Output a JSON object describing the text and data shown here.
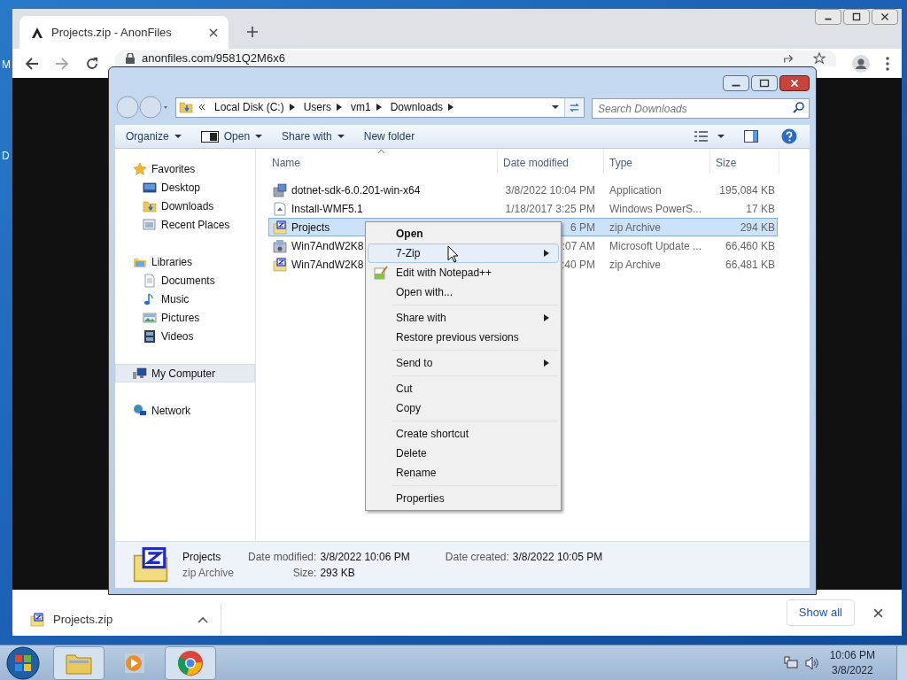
{
  "desktop": {
    "edge_labels": [
      "M",
      "D"
    ]
  },
  "browser": {
    "tabs": [
      {
        "title": "Projects.zip - AnonFiles",
        "selected": true
      }
    ],
    "url": "anonfiles.com/9581Q2M6x6",
    "downloads": [
      {
        "name": "Projects.zip"
      }
    ],
    "show_all": "Show all"
  },
  "explorer": {
    "breadcrumb": [
      "Local Disk (C:)",
      "Users",
      "vm1",
      "Downloads"
    ],
    "search_placeholder": "Search Downloads",
    "toolbar": [
      {
        "label": "Organize",
        "kind": "plain",
        "dropdown": true
      },
      {
        "label": "Open",
        "kind": "open",
        "dropdown": true
      },
      {
        "label": "Share with",
        "kind": "plain",
        "dropdown": true
      },
      {
        "label": "New folder",
        "kind": "plain",
        "dropdown": false
      }
    ],
    "nav": [
      {
        "label": "Favorites",
        "kind": "star",
        "selected": false,
        "children": [
          {
            "label": "Desktop",
            "kind": "desktop",
            "selected": false
          },
          {
            "label": "Downloads",
            "kind": "downloads",
            "selected": false
          },
          {
            "label": "Recent Places",
            "kind": "recent",
            "selected": false
          }
        ]
      },
      {
        "label": "Libraries",
        "kind": "library",
        "selected": false,
        "children": [
          {
            "label": "Documents",
            "kind": "document",
            "selected": false
          },
          {
            "label": "Music",
            "kind": "music",
            "selected": false
          },
          {
            "label": "Pictures",
            "kind": "picture",
            "selected": false
          },
          {
            "label": "Videos",
            "kind": "video",
            "selected": false
          }
        ]
      },
      {
        "label": "My Computer",
        "kind": "computer",
        "selected": true
      },
      {
        "label": "Network",
        "kind": "network",
        "selected": false
      }
    ],
    "columns": [
      "Name",
      "Date modified",
      "Type",
      "Size"
    ],
    "rows": [
      {
        "name": "dotnet-sdk-6.0.201-win-x64",
        "date": "3/8/2022 10:04 PM",
        "type": "Application",
        "size": "195,084 KB",
        "kind": "installer",
        "selected": false
      },
      {
        "name": "Install-WMF5.1",
        "date": "1/18/2017 3:25 PM",
        "type": "Windows PowerS...",
        "size": "17 KB",
        "kind": "script",
        "selected": false
      },
      {
        "name": "Projects",
        "date": "6 PM",
        "type": "zip Archive",
        "size": "294 KB",
        "kind": "zip",
        "selected": true
      },
      {
        "name": "Win7AndW2K8",
        "date": ":07 AM",
        "type": "Microsoft Update ...",
        "size": "66,460 KB",
        "kind": "update",
        "selected": false
      },
      {
        "name": "Win7AndW2K8",
        "date": ":40 PM",
        "type": "zip Archive",
        "size": "66,481 KB",
        "kind": "zip",
        "selected": false
      }
    ],
    "details": {
      "name": "Projects",
      "type": "zip Archive",
      "fields": [
        {
          "label": "Date modified:",
          "value": "3/8/2022 10:06 PM"
        },
        {
          "label": "Size:",
          "value": "293 KB"
        },
        {
          "label": "Date created:",
          "value": "3/8/2022 10:05 PM"
        }
      ]
    }
  },
  "context_menu": {
    "groups": [
      [
        {
          "label": "Open",
          "default": true,
          "submenu": false,
          "kind": "plain",
          "selected": false
        },
        {
          "label": "7-Zip",
          "default": false,
          "submenu": true,
          "kind": "plain",
          "selected": true
        },
        {
          "label": "Edit with Notepad++",
          "default": false,
          "submenu": false,
          "kind": "notepad",
          "selected": false
        },
        {
          "label": "Open with...",
          "default": false,
          "submenu": false,
          "kind": "plain",
          "selected": false
        }
      ],
      [
        {
          "label": "Share with",
          "default": false,
          "submenu": true,
          "kind": "plain",
          "selected": false
        },
        {
          "label": "Restore previous versions",
          "default": false,
          "submenu": false,
          "kind": "plain",
          "selected": false
        }
      ],
      [
        {
          "label": "Send to",
          "default": false,
          "submenu": true,
          "kind": "plain",
          "selected": false
        }
      ],
      [
        {
          "label": "Cut",
          "default": false,
          "submenu": false,
          "kind": "plain",
          "selected": false
        },
        {
          "label": "Copy",
          "default": false,
          "submenu": false,
          "kind": "plain",
          "selected": false
        }
      ],
      [
        {
          "label": "Create shortcut",
          "default": false,
          "submenu": false,
          "kind": "plain",
          "selected": false
        },
        {
          "label": "Delete",
          "default": false,
          "submenu": false,
          "kind": "plain",
          "selected": false
        },
        {
          "label": "Rename",
          "default": false,
          "submenu": false,
          "kind": "plain",
          "selected": false
        }
      ],
      [
        {
          "label": "Properties",
          "default": false,
          "submenu": false,
          "kind": "plain",
          "selected": false
        }
      ]
    ]
  },
  "taskbar": {
    "buttons": [
      {
        "kind": "explorer",
        "active": true
      },
      {
        "kind": "media",
        "active": false
      },
      {
        "kind": "chrome",
        "active": true
      }
    ],
    "time": "10:06 PM",
    "date": "3/8/2022"
  }
}
